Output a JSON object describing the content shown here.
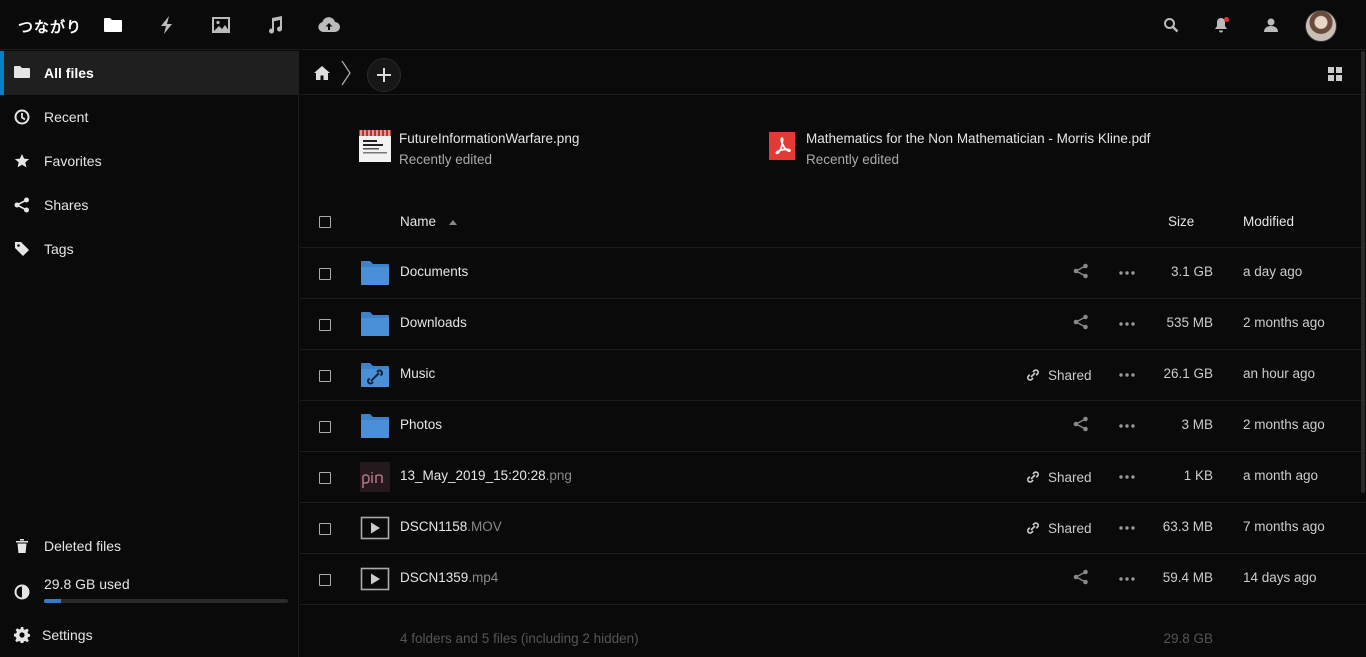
{
  "app": {
    "logo": "つながり"
  },
  "header": {
    "apps": [
      {
        "name": "files-app-icon"
      },
      {
        "name": "activity-app-icon"
      },
      {
        "name": "photos-app-icon"
      },
      {
        "name": "music-app-icon"
      },
      {
        "name": "cloud-upload-app-icon"
      }
    ],
    "accent": "#0082c9"
  },
  "sidebar": {
    "items": [
      {
        "label": "All files",
        "icon": "folder-icon"
      },
      {
        "label": "Recent",
        "icon": "clock-icon"
      },
      {
        "label": "Favorites",
        "icon": "star-icon"
      },
      {
        "label": "Shares",
        "icon": "share-icon"
      },
      {
        "label": "Tags",
        "icon": "tag-icon"
      }
    ],
    "deleted": "Deleted files",
    "quota": {
      "label": "29.8 GB used",
      "fraction": 0.07
    },
    "settings": "Settings"
  },
  "recent": [
    {
      "name": "FutureInformationWarfare.png",
      "sub": "Recently edited"
    },
    {
      "name": "Mathematics for the Non Mathematician - Morris Kline.pdf",
      "sub": "Recently edited"
    }
  ],
  "table": {
    "headers": {
      "name": "Name",
      "size": "Size",
      "modified": "Modified"
    },
    "rows": [
      {
        "base": "Documents",
        "ext": "",
        "size": "3.1 GB",
        "modified": "a day ago",
        "shared": ""
      },
      {
        "base": "Downloads",
        "ext": "",
        "size": "535 MB",
        "modified": "2 months ago",
        "shared": ""
      },
      {
        "base": "Music",
        "ext": "",
        "size": "26.1 GB",
        "modified": "an hour ago",
        "shared": "Shared"
      },
      {
        "base": "Photos",
        "ext": "",
        "size": "3 MB",
        "modified": "2 months ago",
        "shared": ""
      },
      {
        "base": "13_May_2019_15:20:28",
        "ext": ".png",
        "size": "1 KB",
        "modified": "a month ago",
        "shared": "Shared"
      },
      {
        "base": "DSCN1158",
        "ext": ".MOV",
        "size": "63.3 MB",
        "modified": "7 months ago",
        "shared": "Shared"
      },
      {
        "base": "DSCN1359",
        "ext": ".mp4",
        "size": "59.4 MB",
        "modified": "14 days ago",
        "shared": ""
      }
    ],
    "summary": "4 folders and 5 files (including 2 hidden)",
    "total_size": "29.8 GB"
  }
}
